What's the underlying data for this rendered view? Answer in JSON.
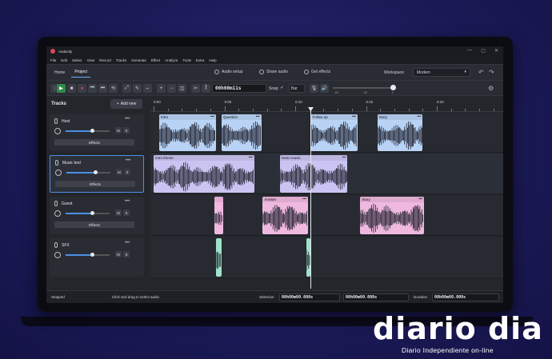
{
  "window": {
    "title": "Audacity",
    "controls": [
      "—",
      "▢",
      "✕"
    ]
  },
  "menu": [
    "File",
    "Edit",
    "Select",
    "View",
    "Record",
    "Tracks",
    "Generate",
    "Effect",
    "Analyze",
    "Tools",
    "Extra",
    "Help"
  ],
  "project_bar": {
    "tabs": [
      "Home",
      "Project"
    ],
    "active_tab": "Project",
    "audio_setup": "Audio setup",
    "share_audio": "Share audio",
    "get_effects": "Get effects",
    "workspace_label": "Workspace",
    "workspace_value": "Modern"
  },
  "toolbar": {
    "timecode": "00h00m11s",
    "snap_label": "Snap",
    "snap_value": "Bar",
    "meter_labels": [
      "-60",
      "-30",
      "0"
    ]
  },
  "tracks_panel": {
    "title": "Tracks",
    "add_new": "Add new"
  },
  "ruler": [
    "0:00",
    "0:05",
    "0:10",
    "0:15",
    "0:20"
  ],
  "tracks": [
    {
      "name": "Host",
      "effects": "Effects",
      "mute": "M",
      "solo": "S",
      "volume": 0.6,
      "selected": false
    },
    {
      "name": "Music bed",
      "effects": "Effects",
      "mute": "M",
      "solo": "S",
      "volume": 0.65,
      "selected": true
    },
    {
      "name": "Guest",
      "effects": "Effects",
      "mute": "M",
      "solo": "S",
      "volume": 0.6,
      "selected": false
    },
    {
      "name": "SFX",
      "effects": "",
      "mute": "M",
      "solo": "S",
      "volume": 0.6,
      "selected": false
    }
  ],
  "clips": [
    {
      "track": 0,
      "label": "Intro",
      "color": "#b8d3f5",
      "start": 0.4,
      "end": 4.4
    },
    {
      "track": 0,
      "label": "Question",
      "color": "#b8d3f5",
      "start": 4.8,
      "end": 7.6
    },
    {
      "track": 0,
      "label": "Follow up",
      "color": "#b8d3f5",
      "start": 11.1,
      "end": 14.4
    },
    {
      "track": 0,
      "label": "Story",
      "color": "#b8d3f5",
      "start": 15.8,
      "end": 19.0
    },
    {
      "track": 1,
      "label": "Intro theme",
      "color": "#cbc4f2",
      "start": 0.0,
      "end": 7.1
    },
    {
      "track": 1,
      "label": "Outro music",
      "color": "#cbc4f2",
      "start": 8.9,
      "end": 13.7
    },
    {
      "track": 2,
      "label": "",
      "color": "#efb8df",
      "start": 4.3,
      "end": 4.9
    },
    {
      "track": 2,
      "label": "Answer",
      "color": "#efb8df",
      "start": 7.7,
      "end": 10.9
    },
    {
      "track": 2,
      "label": "Story",
      "color": "#efb8df",
      "start": 14.6,
      "end": 19.1
    },
    {
      "track": 3,
      "label": "",
      "color": "#9ee3c9",
      "start": 4.4,
      "end": 4.8
    },
    {
      "track": 3,
      "label": "",
      "color": "#9ee3c9",
      "start": 10.8,
      "end": 11.1
    }
  ],
  "status": {
    "state": "Stopped",
    "hint": "Click and drag to select audio",
    "selection_label": "Selection",
    "selection_start": "00h00m00.000s",
    "selection_end": "00h00m00.000s",
    "duration_label": "Duration",
    "duration": "00h00m00.000s"
  },
  "brand": {
    "name": "diario dia",
    "tagline": "Diario Independiente on-line"
  }
}
